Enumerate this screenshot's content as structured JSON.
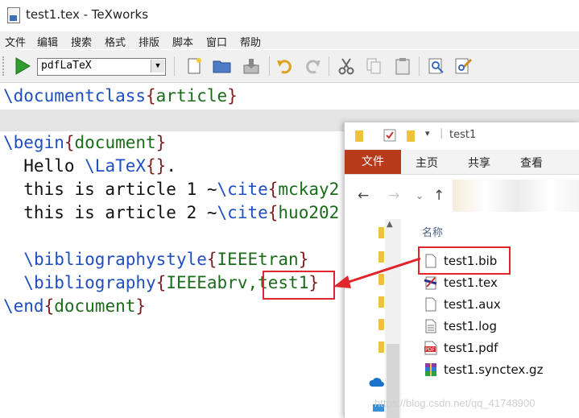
{
  "window": {
    "title": "test1.tex - TeXworks"
  },
  "menu": [
    "文件",
    "编辑",
    "搜索",
    "格式",
    "排版",
    "脚本",
    "窗口",
    "帮助"
  ],
  "toolbar": {
    "engine": "pdfLaTeX"
  },
  "editor": {
    "l1": {
      "cmd": "\\documentclass",
      "arg": "article"
    },
    "l2": {
      "cmd": "\\begin",
      "arg": "document"
    },
    "l3": {
      "text": "  Hello ",
      "cmd": "\\LaTeX",
      "tail": "."
    },
    "l4": {
      "text": "  this is article 1 ",
      "tilde": "~",
      "cmd": "\\cite",
      "arg": "mckay2"
    },
    "l5": {
      "text": "  this is article 2 ",
      "tilde": "~",
      "cmd": "\\cite",
      "arg": "huo202"
    },
    "l6": {
      "cmd": "\\bibliographystyle",
      "arg": "IEEEtran"
    },
    "l7": {
      "cmd": "\\bibliography",
      "arg1": "IEEEabrv,",
      "arg2": "test1"
    },
    "l8": {
      "cmd": "\\end",
      "arg": "document"
    }
  },
  "explorer": {
    "title": "test1",
    "tabs": {
      "file": "文件",
      "home": "主页",
      "share": "共享",
      "view": "查看"
    },
    "column_header": "名称",
    "files": [
      {
        "name": "test1.bib",
        "icon": "blank-file-icon"
      },
      {
        "name": "test1.tex",
        "icon": "texworks-file-icon"
      },
      {
        "name": "test1.aux",
        "icon": "blank-file-icon"
      },
      {
        "name": "test1.log",
        "icon": "text-file-icon"
      },
      {
        "name": "test1.pdf",
        "icon": "pdf-file-icon"
      },
      {
        "name": "test1.synctex.gz",
        "icon": "archive-file-icon"
      }
    ]
  },
  "watermark": "https://blog.csdn.net/qq_41748900",
  "colors": {
    "annotation": "#e0262b",
    "ribbon_file": "#b73a1b",
    "command": "#1f4fbf",
    "argument": "#1a6b1a"
  }
}
